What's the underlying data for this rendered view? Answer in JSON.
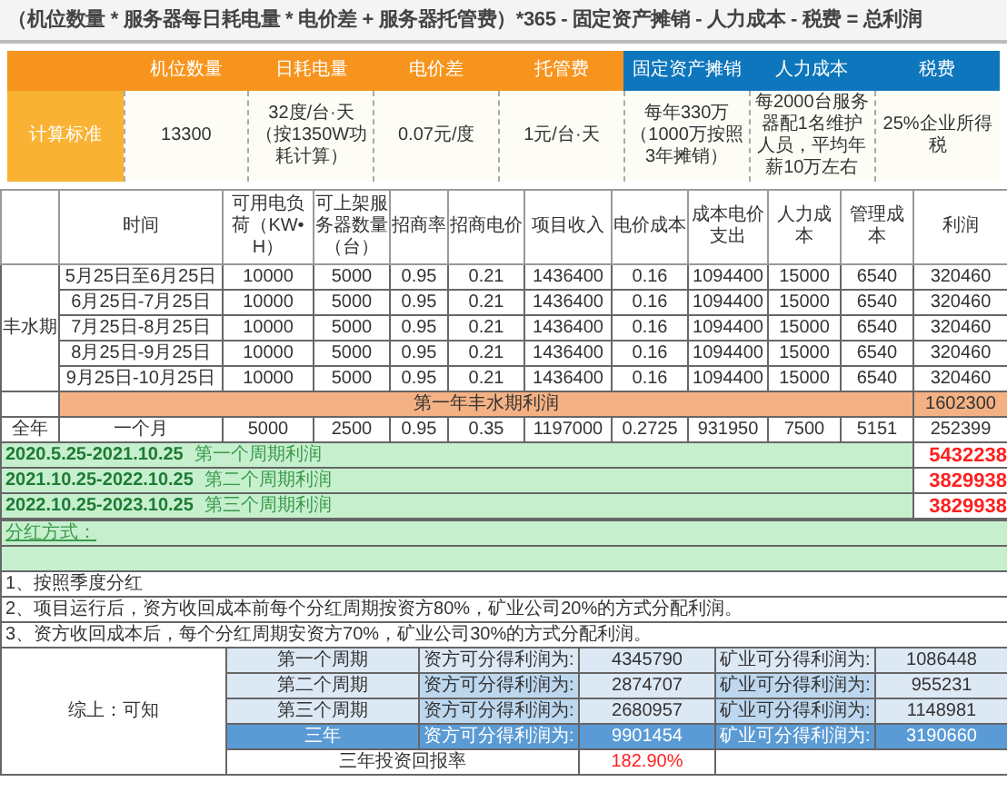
{
  "formula": "（机位数量 * 服务器每日耗电量 * 电价差 + 服务器托管费）*365  - 固定资产摊销 - 人力成本 - 税费 = 总利润",
  "standards": {
    "row_label": "计算标准",
    "columns": [
      {
        "label": "机位数量",
        "value": "13300",
        "color": "#f7941d"
      },
      {
        "label": "日耗电量",
        "value": "32度/台·天（按1350W功耗计算）",
        "color": "#f7941d"
      },
      {
        "label": "电价差",
        "value": "0.07元/度",
        "color": "#f7941d"
      },
      {
        "label": "托管费",
        "value": "1元/台·天",
        "color": "#f7941d"
      },
      {
        "label": "固定资产摊销",
        "value": "每年330万（1000万按照3年摊销）",
        "color": "#0e76bc"
      },
      {
        "label": "人力成本",
        "value": "每2000台服务器配1名维护人员，平均年薪10万左右",
        "color": "#0e76bc"
      },
      {
        "label": "税费",
        "value": "25%企业所得税",
        "color": "#0e76bc"
      }
    ]
  },
  "sheet": {
    "columns": [
      "时间",
      "可用电负荷（KW•H）",
      "可上架服务器数量（台）",
      "招商率",
      "招商电价",
      "项目收入",
      "电价成本",
      "成本电价支出",
      "人力成本",
      "管理成本",
      "利润"
    ],
    "period_label": "丰水期",
    "rows": [
      {
        "cells": [
          "5月25日至6月25日",
          "10000",
          "5000",
          "0.95",
          "0.21",
          "1436400",
          "0.16",
          "1094400",
          "15000",
          "6540",
          "320460"
        ]
      },
      {
        "cells": [
          "6月25日-7月25日",
          "10000",
          "5000",
          "0.95",
          "0.21",
          "1436400",
          "0.16",
          "1094400",
          "15000",
          "6540",
          "320460"
        ]
      },
      {
        "cells": [
          "7月25日-8月25日",
          "10000",
          "5000",
          "0.95",
          "0.21",
          "1436400",
          "0.16",
          "1094400",
          "15000",
          "6540",
          "320460"
        ]
      },
      {
        "cells": [
          "8月25日-9月25日",
          "10000",
          "5000",
          "0.95",
          "0.21",
          "1436400",
          "0.16",
          "1094400",
          "15000",
          "6540",
          "320460"
        ]
      },
      {
        "cells": [
          "9月25日-10月25日",
          "10000",
          "5000",
          "0.95",
          "0.21",
          "1436400",
          "0.16",
          "1094400",
          "15000",
          "6540",
          "320460"
        ]
      }
    ],
    "subtotal": {
      "label": "第一年丰水期利润",
      "value": "1602300"
    },
    "full_year": {
      "label": "全年",
      "cells": [
        "一个月",
        "5000",
        "2500",
        "0.95",
        "0.35",
        "1197000",
        "0.2725",
        "931950",
        "7500",
        "5151",
        "252399"
      ]
    },
    "cycles": [
      {
        "dates": "2020.5.25-2021.10.25",
        "label": "第一个周期利润",
        "value": "5432238"
      },
      {
        "dates": "2021.10.25-2022.10.25",
        "label": "第二个周期利润",
        "value": "3829938"
      },
      {
        "dates": "2022.10.25-2023.10.25",
        "label": "第三个周期利润",
        "value": "3829938"
      }
    ]
  },
  "dividend": {
    "title": "分红方式：",
    "notes": [
      "1、按照季度分红",
      "2、项目运行后，资方收回成本前每个分红周期按资方80%，矿业公司20%的方式分配利润。",
      "3、资方收回成本后，每个分红周期安资方70%，矿业公司30%的方式分配利润。"
    ]
  },
  "summary": {
    "label": "综上：可知",
    "rows": [
      {
        "kind": "cycle",
        "period": "第一个周期",
        "investor_label": "资方可分得利润为:",
        "investor_value": "4345790",
        "mining_label": "矿业可分得利润为:",
        "mining_value": "1086448"
      },
      {
        "kind": "cycle",
        "period": "第二个周期",
        "investor_label": "资方可分得利润为:",
        "investor_value": "2874707",
        "mining_label": "矿业可分得利润为:",
        "mining_value": "955231"
      },
      {
        "kind": "cycle",
        "period": "第三个周期",
        "investor_label": "资方可分得利润为:",
        "investor_value": "2680957",
        "mining_label": "矿业可分得利润为:",
        "mining_value": "1148981"
      },
      {
        "kind": "total",
        "period": "三年",
        "investor_label": "资方可分得利润为:",
        "investor_value": "9901454",
        "mining_label": "矿业可分得利润为:",
        "mining_value": "3190660"
      }
    ],
    "return_label": "三年投资回报率",
    "return_value": "182.90%"
  }
}
